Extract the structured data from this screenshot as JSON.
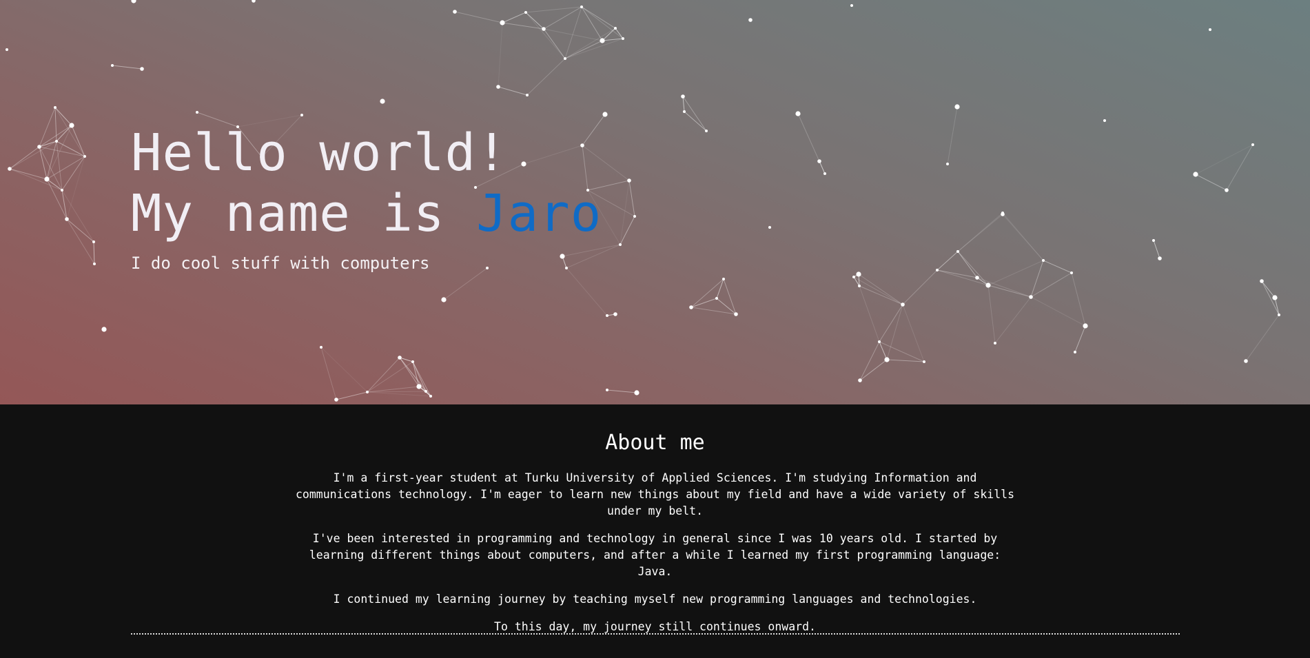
{
  "hero": {
    "line1": "Hello world!",
    "line2_prefix": "My name is ",
    "line2_name": "Jaro",
    "tagline": "I do cool stuff with computers"
  },
  "about": {
    "title": "About me",
    "paragraphs": [
      "I'm a first-year student at Turku University of Applied Sciences. I'm studying Information and communications technology. I'm eager to learn new things about my field and have a wide variety of skills under my belt.",
      "I've been interested in programming and technology in general since I was 10 years old. I started by learning different things about computers, and after a while I learned my first programming language: Java.",
      "I continued my learning journey by teaching myself new programming languages and technologies.",
      "To this day, my journey still continues onward."
    ]
  },
  "colors": {
    "accent": "#0f6bc6",
    "hero_gradient_start": "#945757",
    "hero_gradient_end": "#6c7f80",
    "background": "#111111",
    "text": "#ffffff"
  }
}
